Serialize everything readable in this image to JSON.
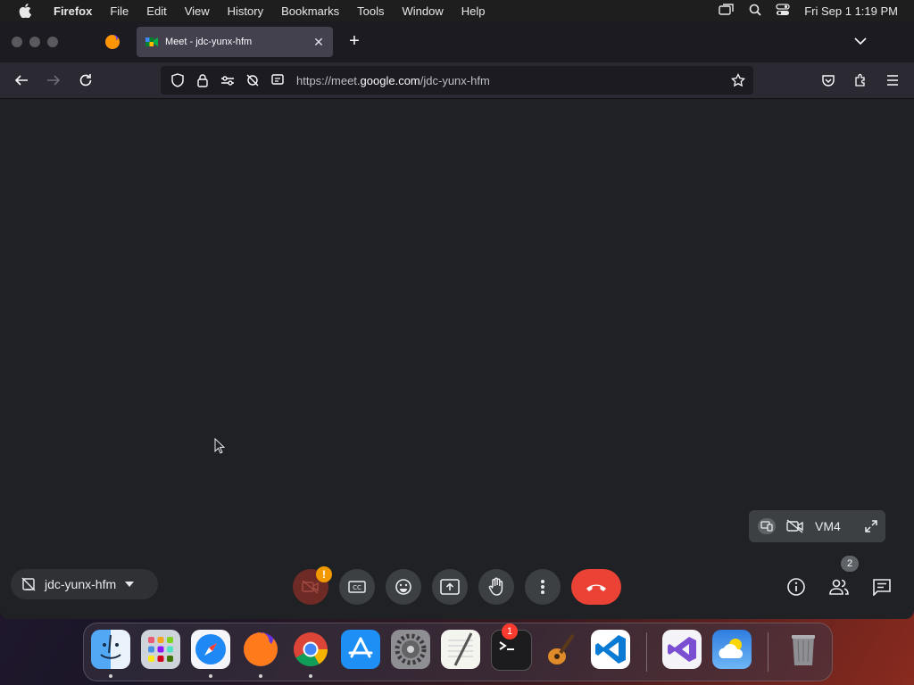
{
  "menubar": {
    "app_name": "Firefox",
    "menus": [
      "File",
      "Edit",
      "View",
      "History",
      "Bookmarks",
      "Tools",
      "Window",
      "Help"
    ],
    "clock": "Fri Sep 1  1:19 PM"
  },
  "browser": {
    "tab_title": "Meet - jdc-yunx-hfm",
    "url_prefix": "https://meet.",
    "url_domain": "google.com",
    "url_path": "/jdc-yunx-hfm"
  },
  "meet": {
    "meeting_code": "jdc-yunx-hfm",
    "self_view_name": "VM4",
    "camera_warning": "!",
    "participant_count": "2",
    "colors": {
      "end_call": "#ea4335",
      "warning": "#f29900",
      "background": "#202124"
    }
  },
  "dock": {
    "apps": [
      "finder-icon",
      "launchpad-icon",
      "safari-icon",
      "firefox-icon",
      "chrome-icon",
      "app-store-icon",
      "system-settings-icon",
      "textedit-icon",
      "terminal-icon",
      "garageband-icon",
      "vscode-icon",
      "visual-studio-icon",
      "weather-icon",
      "trash-icon"
    ],
    "settings_badge": "1"
  }
}
